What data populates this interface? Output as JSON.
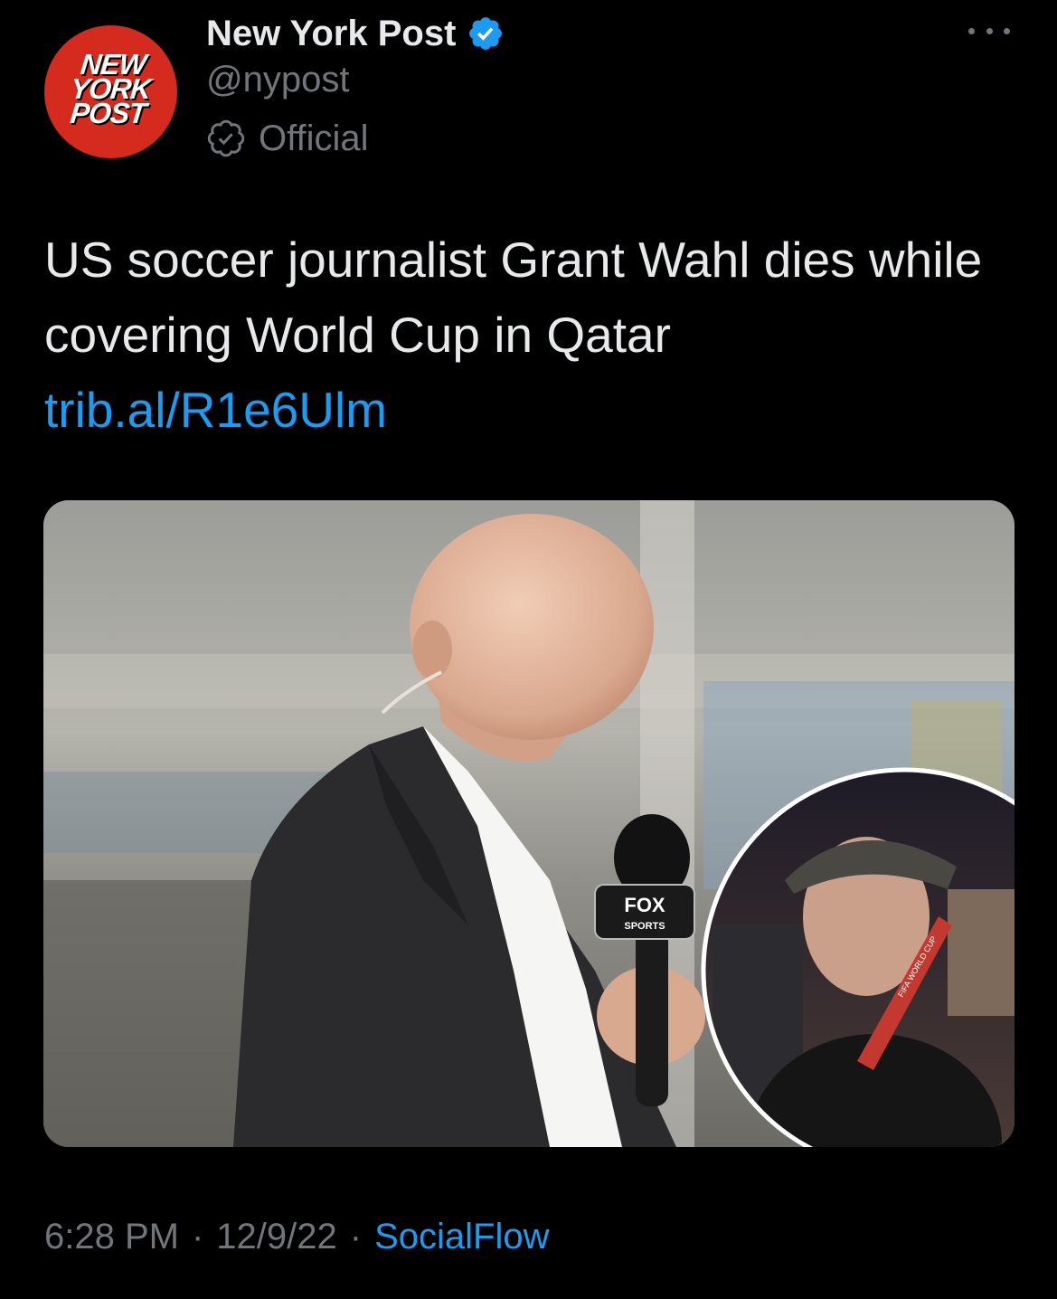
{
  "author": {
    "display_name": "New York Post",
    "handle": "@nypost",
    "badge_label": "Official",
    "avatar_logo_lines": [
      "NEW",
      "YORK",
      "POST"
    ],
    "avatar_color": "#d52b1e",
    "verified_color": "#1d9bf0"
  },
  "tweet": {
    "text": "US soccer journalist Grant Wahl dies while covering World Cup in Qatar",
    "link": "trib.al/R1e6Ulm"
  },
  "media": {
    "mic_flag_brand": "FOX",
    "mic_flag_sub": "SPORTS",
    "inset_lanyard_text": "FIFA WORLD CUP"
  },
  "meta": {
    "time": "6:28 PM",
    "date": "12/9/22",
    "separator": "·",
    "source": "SocialFlow"
  },
  "colors": {
    "background": "#000000",
    "primary_text": "#e7e9ea",
    "secondary_text": "#71767b",
    "link": "#1d9bf0"
  }
}
